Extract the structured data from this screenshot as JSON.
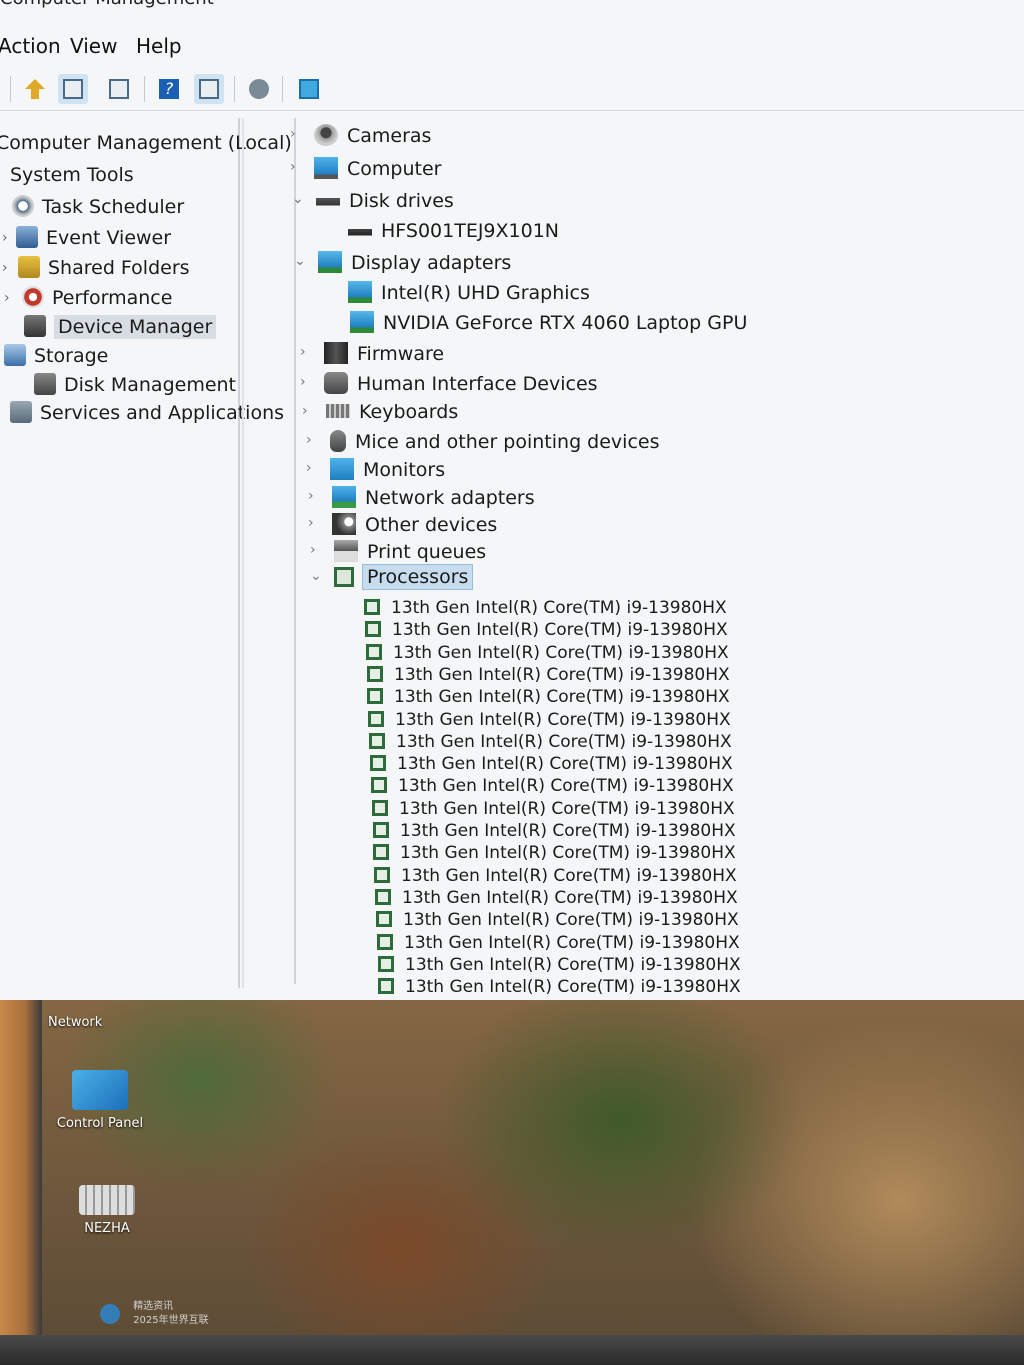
{
  "window": {
    "title": "Computer Management"
  },
  "menu": {
    "action": "Action",
    "view": "View",
    "help": "Help"
  },
  "left_tree": {
    "root": "Computer Management (Local)",
    "system_tools": "System Tools",
    "task_scheduler": "Task Scheduler",
    "event_viewer": "Event Viewer",
    "shared_folders": "Shared Folders",
    "performance": "Performance",
    "device_manager": "Device Manager",
    "storage": "Storage",
    "disk_management": "Disk Management",
    "services": "Services and Applications"
  },
  "devices": {
    "cameras": "Cameras",
    "computer": "Computer",
    "disk_drives": "Disk drives",
    "disk_child": "HFS001TEJ9X101N",
    "display_adapters": "Display adapters",
    "gpu_intel": "Intel(R) UHD Graphics",
    "gpu_nvidia": "NVIDIA GeForce RTX 4060 Laptop GPU",
    "firmware": "Firmware",
    "hid": "Human Interface Devices",
    "keyboards": "Keyboards",
    "mice": "Mice and other pointing devices",
    "monitors": "Monitors",
    "network": "Network adapters",
    "other": "Other devices",
    "print": "Print queues",
    "processors": "Processors"
  },
  "processors": [
    "13th Gen Intel(R) Core(TM) i9-13980HX",
    "13th Gen Intel(R) Core(TM) i9-13980HX",
    "13th Gen Intel(R) Core(TM) i9-13980HX",
    "13th Gen Intel(R) Core(TM) i9-13980HX",
    "13th Gen Intel(R) Core(TM) i9-13980HX",
    "13th Gen Intel(R) Core(TM) i9-13980HX",
    "13th Gen Intel(R) Core(TM) i9-13980HX",
    "13th Gen Intel(R) Core(TM) i9-13980HX",
    "13th Gen Intel(R) Core(TM) i9-13980HX",
    "13th Gen Intel(R) Core(TM) i9-13980HX",
    "13th Gen Intel(R) Core(TM) i9-13980HX",
    "13th Gen Intel(R) Core(TM) i9-13980HX",
    "13th Gen Intel(R) Core(TM) i9-13980HX",
    "13th Gen Intel(R) Core(TM) i9-13980HX",
    "13th Gen Intel(R) Core(TM) i9-13980HX",
    "13th Gen Intel(R) Core(TM) i9-13980HX",
    "13th Gen Intel(R) Core(TM) i9-13980HX",
    "13th Gen Intel(R) Core(TM) i9-13980HX"
  ],
  "desktop": {
    "network": "Network",
    "control_panel": "Control Panel",
    "nezha": "NEZHA",
    "notice_line1": "精选资讯",
    "notice_line2": "2025年世界互联"
  },
  "icons": {
    "toolbar": [
      "up-folder-icon",
      "show-hide-tree-icon",
      "properties-icon",
      "help-icon",
      "action-pane-icon",
      "scan-hardware-icon",
      "monitor-icon"
    ]
  }
}
